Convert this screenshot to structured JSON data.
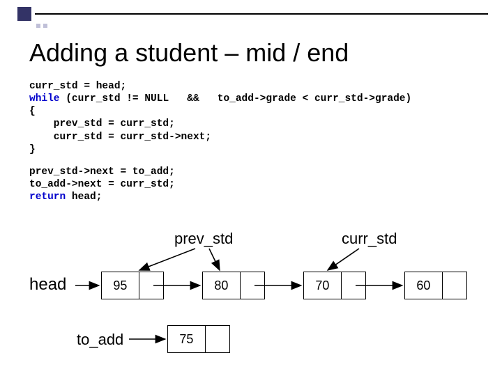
{
  "title": "Adding a student – mid / end",
  "code": {
    "l1a": "curr_std = head;",
    "l2_kw": "while",
    "l2a": " (curr_std != NULL   &&   to_add->grade < curr_std->grade)",
    "l3": "{",
    "l4": "    prev_std = curr_std;",
    "l5": "    curr_std = curr_std->next;",
    "l6": "}",
    "b2l1": "prev_std->next = to_add;",
    "b2l2": "to_add->next = curr_std;",
    "b2l3_kw": "return",
    "b2l3a": " head;"
  },
  "labels": {
    "prev": "prev_std",
    "curr": "curr_std",
    "head": "head",
    "to_add": "to_add"
  },
  "nodes": {
    "n1": "95",
    "n2": "80",
    "n3": "70",
    "n4": "60",
    "nadd": "75"
  }
}
